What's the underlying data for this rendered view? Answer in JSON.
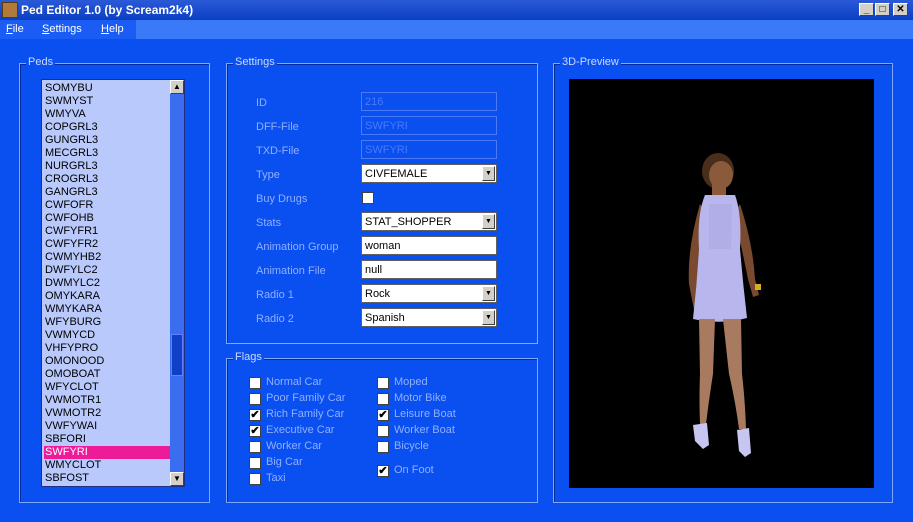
{
  "window": {
    "title": "Ped Editor 1.0 (by Scream2k4)",
    "min": "_",
    "max": "□",
    "close": "✕"
  },
  "menu": [
    {
      "label": "File",
      "mnemonic": "F",
      "rest": "ile"
    },
    {
      "label": "Settings",
      "mnemonic": "S",
      "rest": "ettings"
    },
    {
      "label": "Help",
      "mnemonic": "H",
      "rest": "elp"
    }
  ],
  "peds": {
    "label": "Peds",
    "items": [
      "SOMYBU",
      "SWMYST",
      "WMYVA",
      "COPGRL3",
      "GUNGRL3",
      "MECGRL3",
      "NURGRL3",
      "CROGRL3",
      "GANGRL3",
      "CWFOFR",
      "CWFOHB",
      "CWFYFR1",
      "CWFYFR2",
      "CWMYHB2",
      "DWFYLC2",
      "DWMYLC2",
      "OMYKARA",
      "WMYKARA",
      "WFYBURG",
      "VWMYCD",
      "VHFYPRO",
      "OMONOOD",
      "OMOBOAT",
      "WFYCLOT",
      "VWMOTR1",
      "VWMOTR2",
      "VWFYWAI",
      "SBFORI",
      "SWFYRI",
      "WMYCLOT",
      "SBFOST"
    ],
    "selected": "SWFYRI",
    "scroll_up": "▲",
    "scroll_down": "▼"
  },
  "settings": {
    "label": "Settings",
    "id_label": "ID",
    "id_value": "216",
    "dff_label": "DFF-File",
    "dff_value": "SWFYRI",
    "txd_label": "TXD-File",
    "txd_value": "SWFYRI",
    "type_label": "Type",
    "type_value": "CIVFEMALE",
    "buy_drugs_label": "Buy Drugs",
    "buy_drugs": false,
    "stats_label": "Stats",
    "stats_value": "STAT_SHOPPER",
    "anim_group_label": "Animation Group",
    "anim_group_value": "woman",
    "anim_file_label": "Animation File",
    "anim_file_value": "null",
    "radio1_label": "Radio 1",
    "radio1_value": "Rock",
    "radio2_label": "Radio 2",
    "radio2_value": "Spanish",
    "dropdown_arrow": "▼"
  },
  "flags": {
    "label": "Flags",
    "left": [
      {
        "label": "Normal Car",
        "checked": false
      },
      {
        "label": "Poor Family Car",
        "checked": false
      },
      {
        "label": "Rich Family Car",
        "checked": true
      },
      {
        "label": "Executive Car",
        "checked": true
      },
      {
        "label": "Worker Car",
        "checked": false
      },
      {
        "label": "Big Car",
        "checked": false
      },
      {
        "label": "Taxi",
        "checked": false
      }
    ],
    "right": [
      {
        "label": "Moped",
        "checked": false
      },
      {
        "label": "Motor Bike",
        "checked": false
      },
      {
        "label": "Leisure Boat",
        "checked": true
      },
      {
        "label": "Worker Boat",
        "checked": false
      },
      {
        "label": "Bicycle",
        "checked": false
      },
      {
        "label": "On Foot",
        "checked": true
      }
    ],
    "check_mark": "✔"
  },
  "preview": {
    "label": "3D-Preview"
  },
  "colors": {
    "background": "#0a4ff0",
    "selection": "#ee1b99",
    "list_bg": "#b9c9fb"
  }
}
